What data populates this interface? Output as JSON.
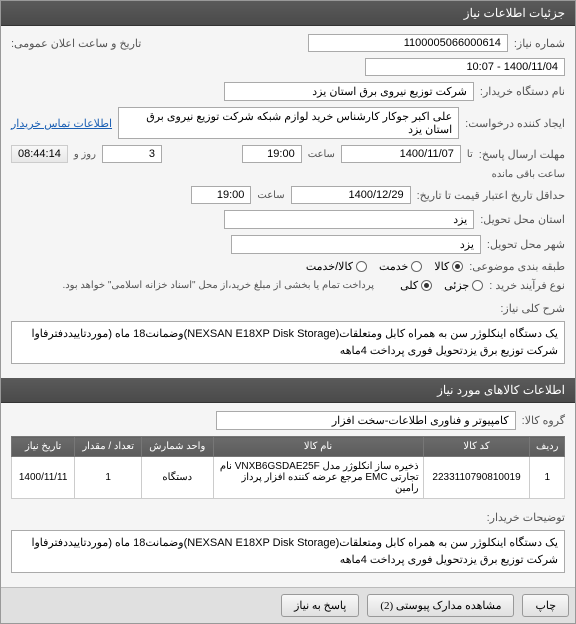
{
  "sections": {
    "header1": "جزئیات اطلاعات نیاز",
    "header2": "اطلاعات کالاهای مورد نیاز"
  },
  "fields": {
    "need_number_label": "شماره نیاز:",
    "need_number": "1100005066000614",
    "announce_label": "تاریخ و ساعت اعلان عمومی:",
    "announce_value": "1400/11/04 - 10:07",
    "buyer_device_label": "نام دستگاه خریدار:",
    "buyer_device": "شرکت توزیع نیروی برق استان یزد",
    "creator_label": "ایجاد کننده درخواست:",
    "creator": "علی اکبر  جوکار  کارشناس خرید لوازم شبکه  شرکت توزیع نیروی برق استان یزد",
    "contact_link": "اطلاعات تماس خریدار",
    "response_deadline_label": "مهلت ارسال پاسخ:",
    "response_date": "1400/11/07",
    "response_time": "19:00",
    "time_label": "ساعت",
    "days_label": "روز و",
    "days_value": "3",
    "remaining_time": "08:44:14",
    "remaining_label": "ساعت باقی مانده",
    "until_label": "تا",
    "validity_label": "حداقل تاریخ اعتبار قیمت تا تاریخ:",
    "validity_date": "1400/12/29",
    "validity_time": "19:00",
    "province_label": "استان محل تحویل:",
    "province": "یزد",
    "city_label": "شهر محل تحویل:",
    "city": "یزد",
    "pbs_label": "طبقه بندی موضوعی:",
    "pbs_goods": "کالا",
    "pbs_service": "خدمت",
    "pbs_both": "کالا/خدمت",
    "purchase_process_label": "نوع فرآیند خرید :",
    "purchase_partial": "جزئی",
    "purchase_full": "کلی",
    "purchase_note": "پرداخت تمام یا بخشی از مبلغ خرید،از محل \"اسناد خزانه اسلامی\" خواهد بود.",
    "desc_label": "شرح کلی نیاز:",
    "desc_text": "یک دستگاه اینکلوژر سن به همراه کابل ومتعلقات(NEXSAN E18XP Disk Storage)وضمانت18 ماه (موردتاییددفترفاوا شرکت توزیع برق یزدتحویل فوری پرداخت 4ماهه",
    "goods_group_label": "گروه کالا:",
    "goods_group": "کامپیوتر و فناوری اطلاعات-سخت افزار",
    "buyer_notes_label": "توضیحات خریدار:",
    "buyer_notes": "یک دستگاه اینکلوژر سن به همراه کابل ومتعلقات(NEXSAN E18XP Disk Storage)وضمانت18 ماه (موردتاییددفترفاوا شرکت توزیع برق یزدتحویل فوری پرداخت 4ماهه"
  },
  "table": {
    "headers": {
      "row": "ردیف",
      "code": "کد کالا",
      "name": "نام کالا",
      "unit": "واحد شمارش",
      "qty": "تعداد / مقدار",
      "date": "تاریخ نیاز"
    },
    "rows": [
      {
        "row": "1",
        "code": "2233110790810019",
        "name": "ذخیره ساز انکلوژر مدل VNXB6GSDAE25F نام تجارتی EMC مرجع عرضه کننده افزار پرداز رامین",
        "unit": "دستگاه",
        "qty": "1",
        "date": "1400/11/11"
      }
    ]
  },
  "footer": {
    "print": "چاپ",
    "attachments": "مشاهده مدارک پیوستی (2)",
    "reply": "پاسخ به نیاز"
  }
}
